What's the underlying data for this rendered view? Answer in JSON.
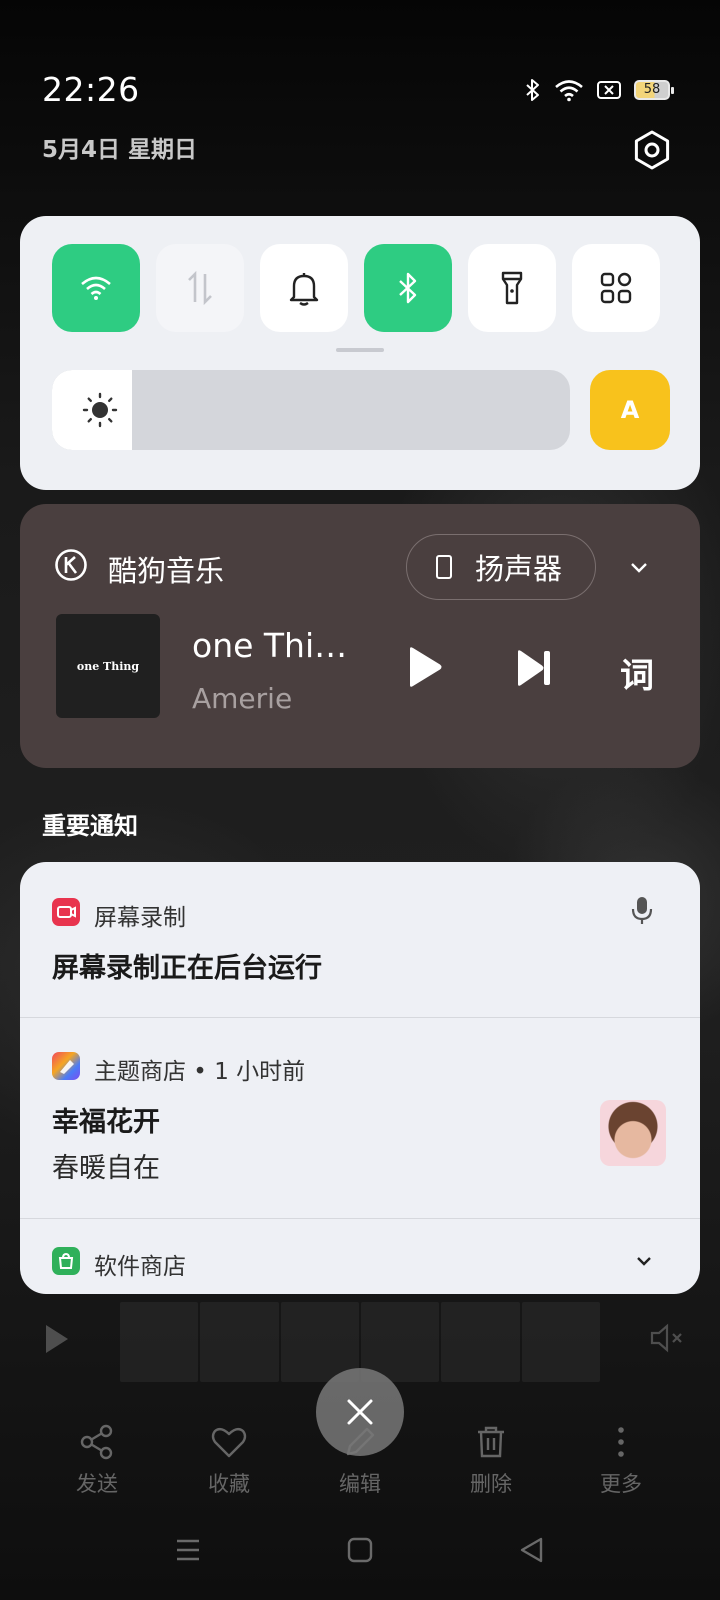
{
  "status_bar": {
    "time": "22:26",
    "date": "5月4日 星期日",
    "battery": "58"
  },
  "quick_settings": {
    "tiles": [
      {
        "name": "wifi",
        "icon": "wifi-icon",
        "on": true
      },
      {
        "name": "mobile-data",
        "icon": "data-arrows-icon",
        "on": false
      },
      {
        "name": "ring",
        "icon": "bell-icon",
        "on": false
      },
      {
        "name": "bluetooth",
        "icon": "bluetooth-icon",
        "on": true
      },
      {
        "name": "flashlight",
        "icon": "flashlight-icon",
        "on": false
      },
      {
        "name": "more",
        "icon": "grid-icon",
        "on": false
      }
    ],
    "brightness_level": 0.155,
    "auto_label": "A",
    "colors": {
      "on": "#2ecc82",
      "auto": "#f8c21c"
    }
  },
  "media": {
    "app_name": "酷狗音乐",
    "output_device": "扬声器",
    "cover_text": "one Thing",
    "track_title": "one Thin...",
    "artist": "Amerie",
    "lyrics_label": "词"
  },
  "notifications_header": "重要通知",
  "notifications": [
    {
      "app": "屏幕录制",
      "title": "屏幕录制正在后台运行",
      "badge_color": "#e8344e"
    },
    {
      "app": "主题商店 • 1 小时前",
      "title": "幸福花开",
      "body": "春暖自在",
      "badge_color": "#6a5cf0"
    },
    {
      "app": "软件商店",
      "badge_color": "#2fb05a"
    }
  ],
  "background_app": {
    "actions": [
      "发送",
      "收藏",
      "编辑",
      "删除",
      "更多"
    ]
  }
}
